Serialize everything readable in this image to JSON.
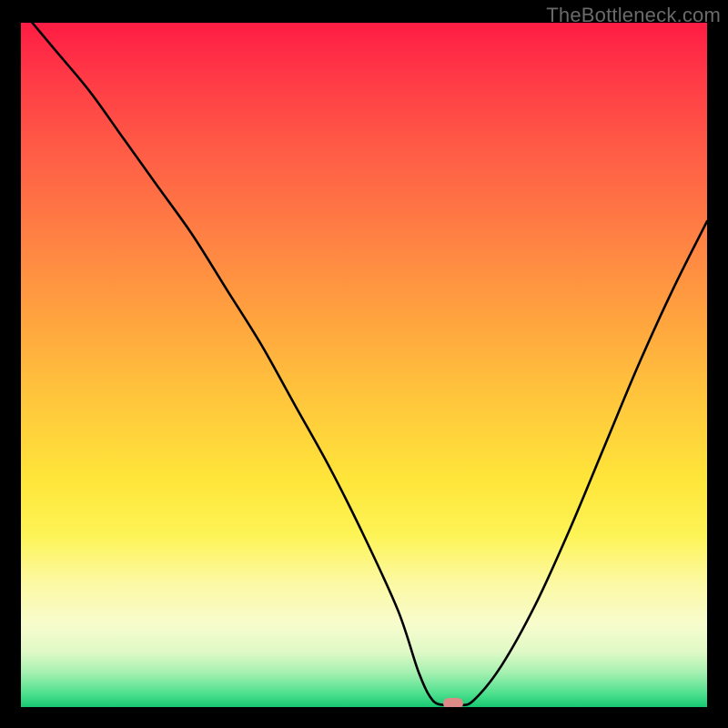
{
  "watermark": "TheBottleneck.com",
  "chart_data": {
    "type": "line",
    "title": "",
    "xlabel": "",
    "ylabel": "",
    "xlim": [
      0,
      100
    ],
    "ylim": [
      0,
      100
    ],
    "series": [
      {
        "name": "bottleneck-curve",
        "x": [
          0,
          5,
          10,
          15,
          20,
          25,
          30,
          35,
          40,
          45,
          50,
          55,
          58,
          60,
          62,
          64,
          66,
          70,
          75,
          80,
          85,
          90,
          95,
          100
        ],
        "values": [
          102,
          96,
          90,
          83,
          76,
          69,
          61,
          53,
          44,
          35,
          25,
          14,
          5,
          1,
          0,
          0,
          1,
          6,
          15,
          26,
          38,
          50,
          61,
          71
        ]
      }
    ],
    "marker": {
      "x": 63,
      "y": 0
    },
    "gradient_stops": [
      {
        "pct": 0,
        "color": "#ff1c44"
      },
      {
        "pct": 50,
        "color": "#ffcf3b"
      },
      {
        "pct": 85,
        "color": "#fbf9b8"
      },
      {
        "pct": 100,
        "color": "#16c872"
      }
    ]
  }
}
